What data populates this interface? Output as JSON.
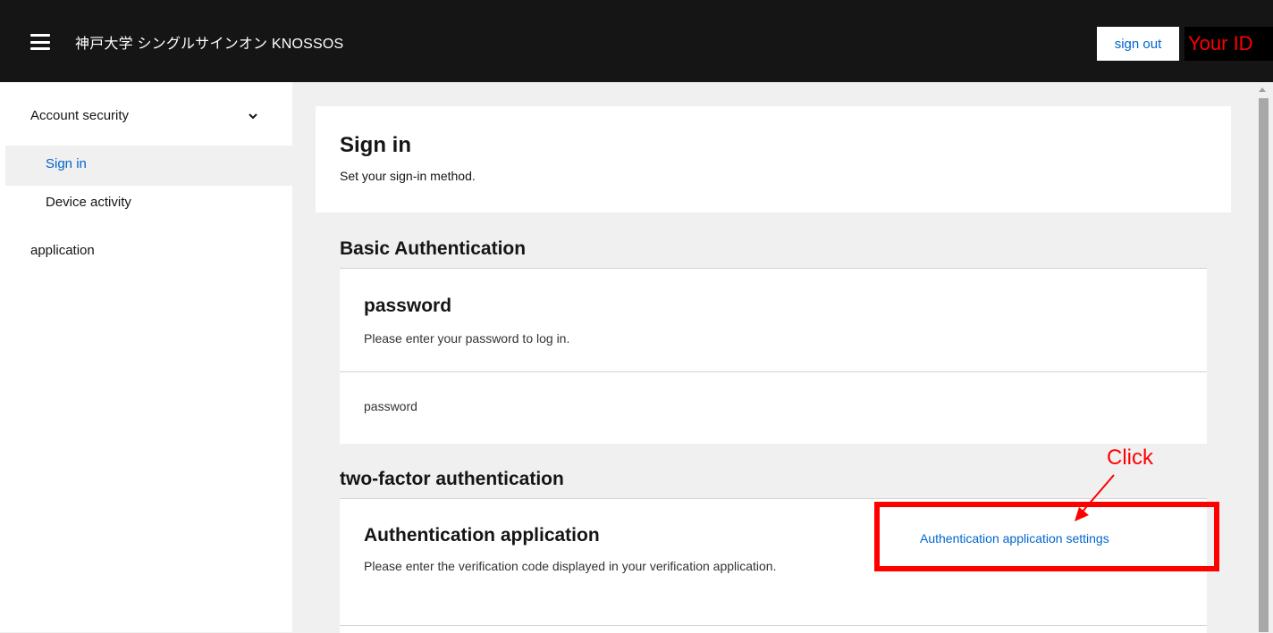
{
  "header": {
    "menu_icon": "hamburger-icon",
    "brand": "神戸大学 シングルサインオン KNOSSOS",
    "signout_label": "sign out",
    "your_id_label": "Your ID"
  },
  "sidebar": {
    "group_label": "Account security",
    "group_icon": "chevron-down-icon",
    "items": [
      {
        "label": "Sign in",
        "active": true
      },
      {
        "label": "Device activity",
        "active": false
      }
    ],
    "application_label": "application"
  },
  "main": {
    "title": "Sign in",
    "subtitle": "Set your sign-in method.",
    "basic": {
      "section_title": "Basic Authentication",
      "item_title": "password",
      "item_desc": "Please enter your password to log in.",
      "row_value": "password"
    },
    "two_factor": {
      "section_title": "two-factor authentication",
      "item_title": "Authentication application",
      "item_desc": "Please enter the verification code displayed in your verification application.",
      "settings_link": "Authentication application settings"
    }
  },
  "annotation": {
    "click_label": "Click",
    "color": "#ff0000"
  },
  "colors": {
    "topbar": "#151515",
    "link": "#0066cc",
    "background": "#f0f0f0"
  }
}
